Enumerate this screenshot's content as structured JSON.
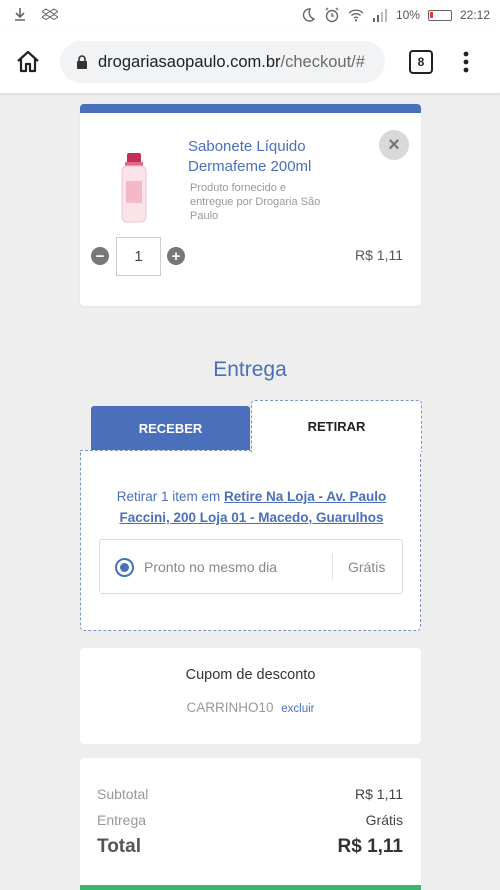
{
  "status_bar": {
    "battery": "10%",
    "time": "22:12",
    "icons": [
      "download-icon",
      "dropbox-icon",
      "moon-icon",
      "alarm-icon",
      "wifi-icon",
      "signal-icon",
      "battery-icon"
    ]
  },
  "browser": {
    "url_domain": "drogariasaopaulo.com.br",
    "url_path": "/checkout/#",
    "tab_count": "8"
  },
  "product": {
    "name": "Sabonete Líquido Dermafeme 200ml",
    "seller": "Produto fornecido e entregue por Drogaria São Paulo",
    "quantity": "1",
    "price": "R$ 1,11",
    "remove_icon": "×"
  },
  "delivery": {
    "title": "Entrega",
    "tab_receive": "RECEBER",
    "tab_pickup": "RETIRAR",
    "pickup_prefix": "Retirar 1 item em",
    "pickup_store": "Retire Na Loja - Av. Paulo Faccini, 200 Loja 01 - Macedo, Guarulhos",
    "option_label": "Pronto no mesmo dia",
    "option_price": "Grátis"
  },
  "coupon": {
    "title": "Cupom de desconto",
    "code": "CARRINHO10",
    "remove_label": "excluir"
  },
  "summary": {
    "subtotal_label": "Subtotal",
    "subtotal_value": "R$ 1,11",
    "shipping_label": "Entrega",
    "shipping_value": "Grátis",
    "total_label": "Total",
    "total_value": "R$ 1,11"
  },
  "colors": {
    "accent": "#4a6fbb",
    "success": "#3fb36c",
    "background": "#eeeeee"
  }
}
